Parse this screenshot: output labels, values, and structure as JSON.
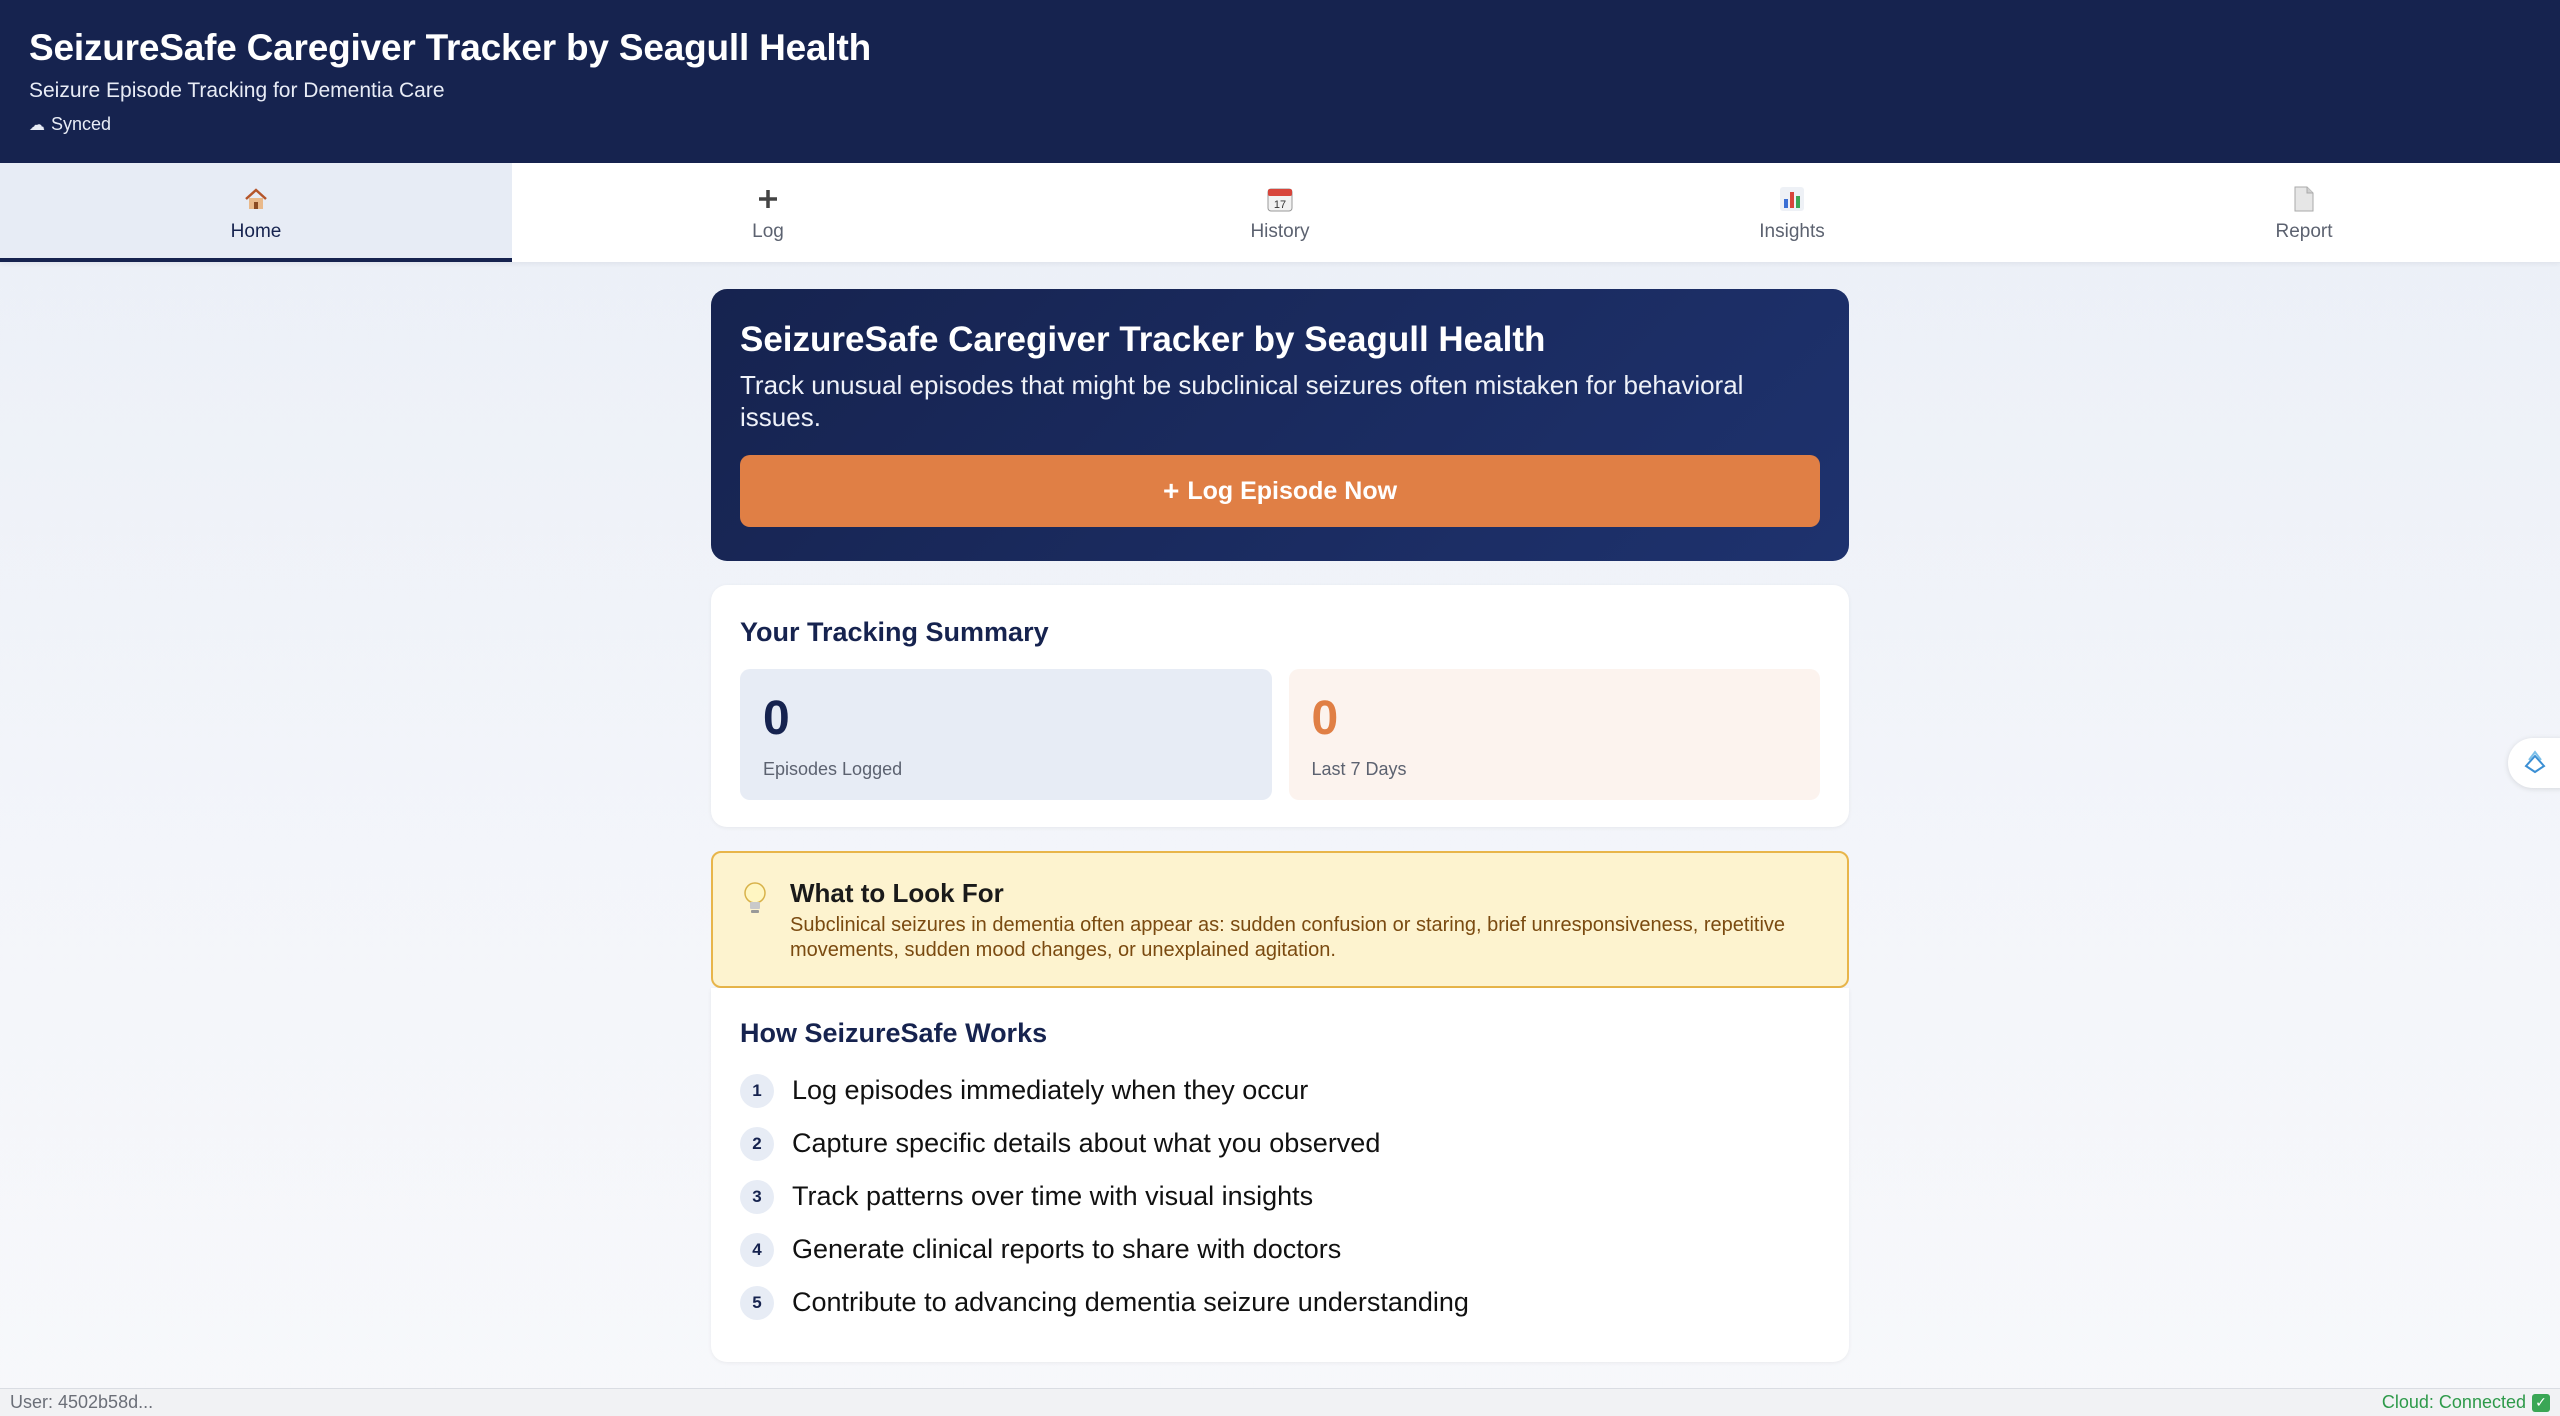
{
  "header": {
    "title": "SeizureSafe Caregiver Tracker by Seagull Health",
    "subtitle": "Seizure Episode Tracking for Dementia Care",
    "sync_label": "Synced"
  },
  "tabs": [
    {
      "label": "Home",
      "icon": "house-icon",
      "active": true
    },
    {
      "label": "Log",
      "icon": "plus-icon",
      "active": false
    },
    {
      "label": "History",
      "icon": "calendar-icon",
      "active": false
    },
    {
      "label": "Insights",
      "icon": "bar-chart-icon",
      "active": false
    },
    {
      "label": "Report",
      "icon": "document-icon",
      "active": false
    }
  ],
  "hero": {
    "title": "SeizureSafe Caregiver Tracker by Seagull Health",
    "description": "Track unusual episodes that might be subclinical seizures often mistaken for behavioral issues.",
    "button_label": "Log Episode Now"
  },
  "summary": {
    "title": "Your Tracking Summary",
    "episodes_logged": {
      "value": "0",
      "label": "Episodes Logged"
    },
    "last_7_days": {
      "value": "0",
      "label": "Last 7 Days"
    }
  },
  "tip": {
    "title": "What to Look For",
    "body": "Subclinical seizures in dementia often appear as: sudden confusion or staring, brief unresponsiveness, repetitive movements, sudden mood changes, or unexplained agitation."
  },
  "how_it_works": {
    "title": "How SeizureSafe Works",
    "steps": [
      {
        "num": "1",
        "text": "Log episodes immediately when they occur"
      },
      {
        "num": "2",
        "text": "Capture specific details about what you observed"
      },
      {
        "num": "3",
        "text": "Track patterns over time with visual insights"
      },
      {
        "num": "4",
        "text": "Generate clinical reports to share with doctors"
      },
      {
        "num": "5",
        "text": "Contribute to advancing dementia seizure understanding"
      }
    ]
  },
  "footer": {
    "user": "User: 4502b58d...",
    "cloud": "Cloud: Connected"
  },
  "colors": {
    "navy": "#16234f",
    "accent_orange": "#e07f45",
    "tip_bg": "#fdf3cf",
    "success_green": "#3aa655"
  }
}
